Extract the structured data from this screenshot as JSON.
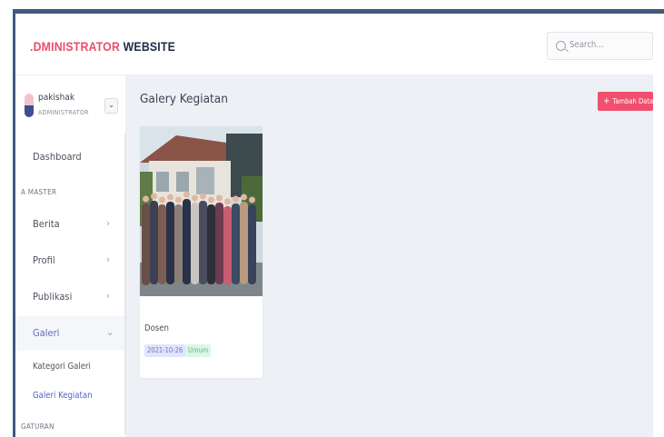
{
  "header": {
    "brand_accent": ".DMINISTRATOR",
    "brand_main": " WEBSITE",
    "search_placeholder": "Search..."
  },
  "user": {
    "name": "pakishak",
    "role": "ADMINISTRATOR",
    "menu_icon": "chevron-down-icon"
  },
  "sidebar": {
    "dashboard": "Dashboard",
    "section_master": "A MASTER",
    "items": [
      {
        "label": "Berita",
        "chevron": "›"
      },
      {
        "label": "Profil",
        "chevron": "›"
      },
      {
        "label": "Publikasi",
        "chevron": "›"
      },
      {
        "label": "Galeri",
        "chevron": "⌄"
      }
    ],
    "sub_items": [
      "Kategori Galeri",
      "Galeri Kegiatan"
    ],
    "section_settings": "GATURAN"
  },
  "main": {
    "title": "Galery Kegiatan",
    "add_button": "Tambah Data",
    "cards": [
      {
        "title": "Dosen",
        "date": "2021-10-26",
        "category": "Umum"
      }
    ]
  },
  "colors": {
    "brand_accent": "#ee4b6a",
    "brand_dark": "#1f2c44",
    "add_button": "#f0506e",
    "active_link": "#4f63c4",
    "content_bg": "#edf0f5"
  }
}
